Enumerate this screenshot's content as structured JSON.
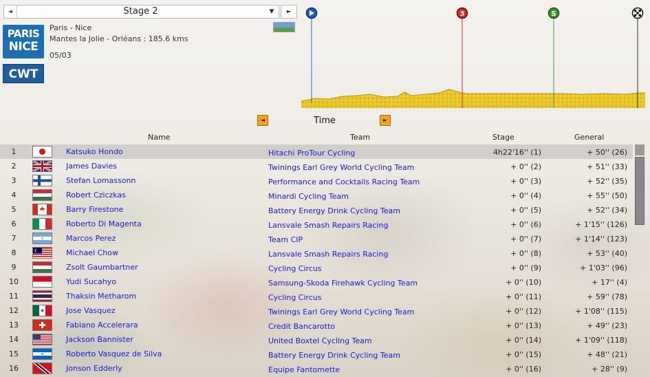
{
  "stage_selector": {
    "label": "Stage 2",
    "prev_icon": "◄",
    "dropdown_icon": "▼",
    "next_icon": "►"
  },
  "race": {
    "logo_line1": "PARIS",
    "logo_line2": "NICE",
    "category": "CWT",
    "name": "Paris - Nice",
    "route": "Mantes la Jolie - Orléans : 185.6 kms",
    "date": "05/03"
  },
  "profile": {
    "markers": [
      {
        "name": "start",
        "label": "▶",
        "color": "#1f5fcf"
      },
      {
        "name": "climb-3",
        "label": "3",
        "color": "#d42a2a"
      },
      {
        "name": "sprint",
        "label": "S",
        "color": "#3c9a2a"
      },
      {
        "name": "finish",
        "label": "",
        "color": "#111"
      }
    ],
    "colors": {
      "terrain": "#e8c72a",
      "terrain_dark": "#b59210"
    }
  },
  "sort": {
    "label": "Time",
    "prev_icon": "◄",
    "next_icon": "►"
  },
  "columns": {
    "name": "Name",
    "team": "Team",
    "stage": "Stage",
    "general": "General"
  },
  "riders": [
    {
      "pos": "1",
      "flag": "japan",
      "name": "Katsuko Hondo",
      "team": "Hitachi ProTour Cycling",
      "stage": "4h22'16'' (1)",
      "general": "+ 50'' (26)"
    },
    {
      "pos": "2",
      "flag": "uk",
      "name": "James Davies",
      "team": "Twinings Earl Grey World Cycling Team",
      "stage": "+ 0'' (2)",
      "general": "+ 51'' (33)"
    },
    {
      "pos": "3",
      "flag": "finland",
      "name": "Stefan Lomassonn",
      "team": "Performance and Cocktails Racing Team",
      "stage": "+ 0'' (3)",
      "general": "+ 52'' (35)"
    },
    {
      "pos": "4",
      "flag": "hungary",
      "name": "Robert Cziczkas",
      "team": "Minardi Cycling Team",
      "stage": "+ 0'' (4)",
      "general": "+ 55'' (50)"
    },
    {
      "pos": "5",
      "flag": "canada",
      "name": "Barry Firestone",
      "team": "Battery Energy Drink Cycling Team",
      "stage": "+ 0'' (5)",
      "general": "+ 52'' (34)"
    },
    {
      "pos": "6",
      "flag": "italy",
      "name": "Roberto Di Magenta",
      "team": "Lansvale Smash Repairs Racing",
      "stage": "+ 0'' (6)",
      "general": "+ 1'15'' (126)"
    },
    {
      "pos": "7",
      "flag": "argentina",
      "name": "Marcos Perez",
      "team": "Team CIP",
      "stage": "+ 0'' (7)",
      "general": "+ 1'14'' (123)"
    },
    {
      "pos": "8",
      "flag": "malaysia",
      "name": "Michael Chow",
      "team": "Lansvale Smash Repairs Racing",
      "stage": "+ 0'' (8)",
      "general": "+ 53'' (40)"
    },
    {
      "pos": "9",
      "flag": "hungary",
      "name": "Zsolt Gaumbartner",
      "team": "Cycling Circus",
      "stage": "+ 0'' (9)",
      "general": "+ 1'03'' (96)"
    },
    {
      "pos": "10",
      "flag": "indonesia",
      "name": "Yudi Sucahyo",
      "team": "Samsung-Skoda Firehawk Cycling Team",
      "stage": "+ 0'' (10)",
      "general": "+ 17'' (4)"
    },
    {
      "pos": "11",
      "flag": "thailand",
      "name": "Thaksin Metharom",
      "team": "Cycling Circus",
      "stage": "+ 0'' (11)",
      "general": "+ 59'' (78)"
    },
    {
      "pos": "12",
      "flag": "mexico",
      "name": "Jose Vasquez",
      "team": "Twinings Earl Grey World Cycling Team",
      "stage": "+ 0'' (12)",
      "general": "+ 1'08'' (115)"
    },
    {
      "pos": "13",
      "flag": "switzerland",
      "name": "Fabiano Accelerara",
      "team": "Credit Bancarotto",
      "stage": "+ 0'' (13)",
      "general": "+ 49'' (23)"
    },
    {
      "pos": "14",
      "flag": "usa",
      "name": "Jackson Bannister",
      "team": "United Boxtel Cycling Team",
      "stage": "+ 0'' (14)",
      "general": "+ 1'09'' (118)"
    },
    {
      "pos": "15",
      "flag": "nicaragua",
      "name": "Roberto Vasquez de Silva",
      "team": "Battery Energy Drink Cycling Team",
      "stage": "+ 0'' (15)",
      "general": "+ 48'' (21)"
    },
    {
      "pos": "16",
      "flag": "trinidad",
      "name": "Jonson Edderly",
      "team": "Equipe Fantomette",
      "stage": "+ 0'' (16)",
      "general": "+ 28'' (9)"
    }
  ]
}
